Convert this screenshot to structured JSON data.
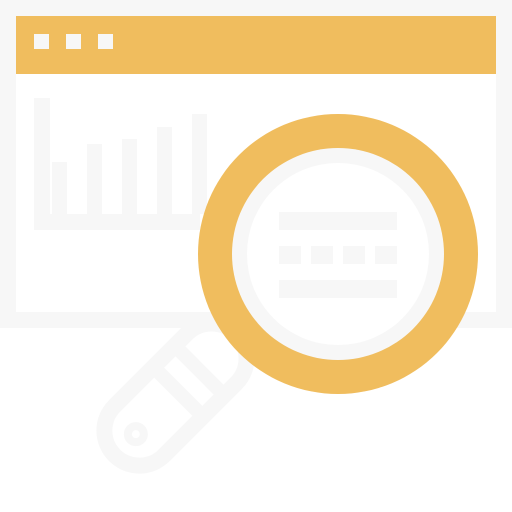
{
  "illustration": {
    "icon": "browser-window-with-analytics-and-magnifying-glass",
    "colors": {
      "accent": "#F0BD5E",
      "line": "#F7F7F7",
      "background": "#FFFFFF"
    },
    "window": {
      "title_bar_dots": 3
    },
    "bar_chart": {
      "relative_bar_heights": [
        0.45,
        0.6,
        0.65,
        0.75,
        0.86
      ]
    }
  }
}
